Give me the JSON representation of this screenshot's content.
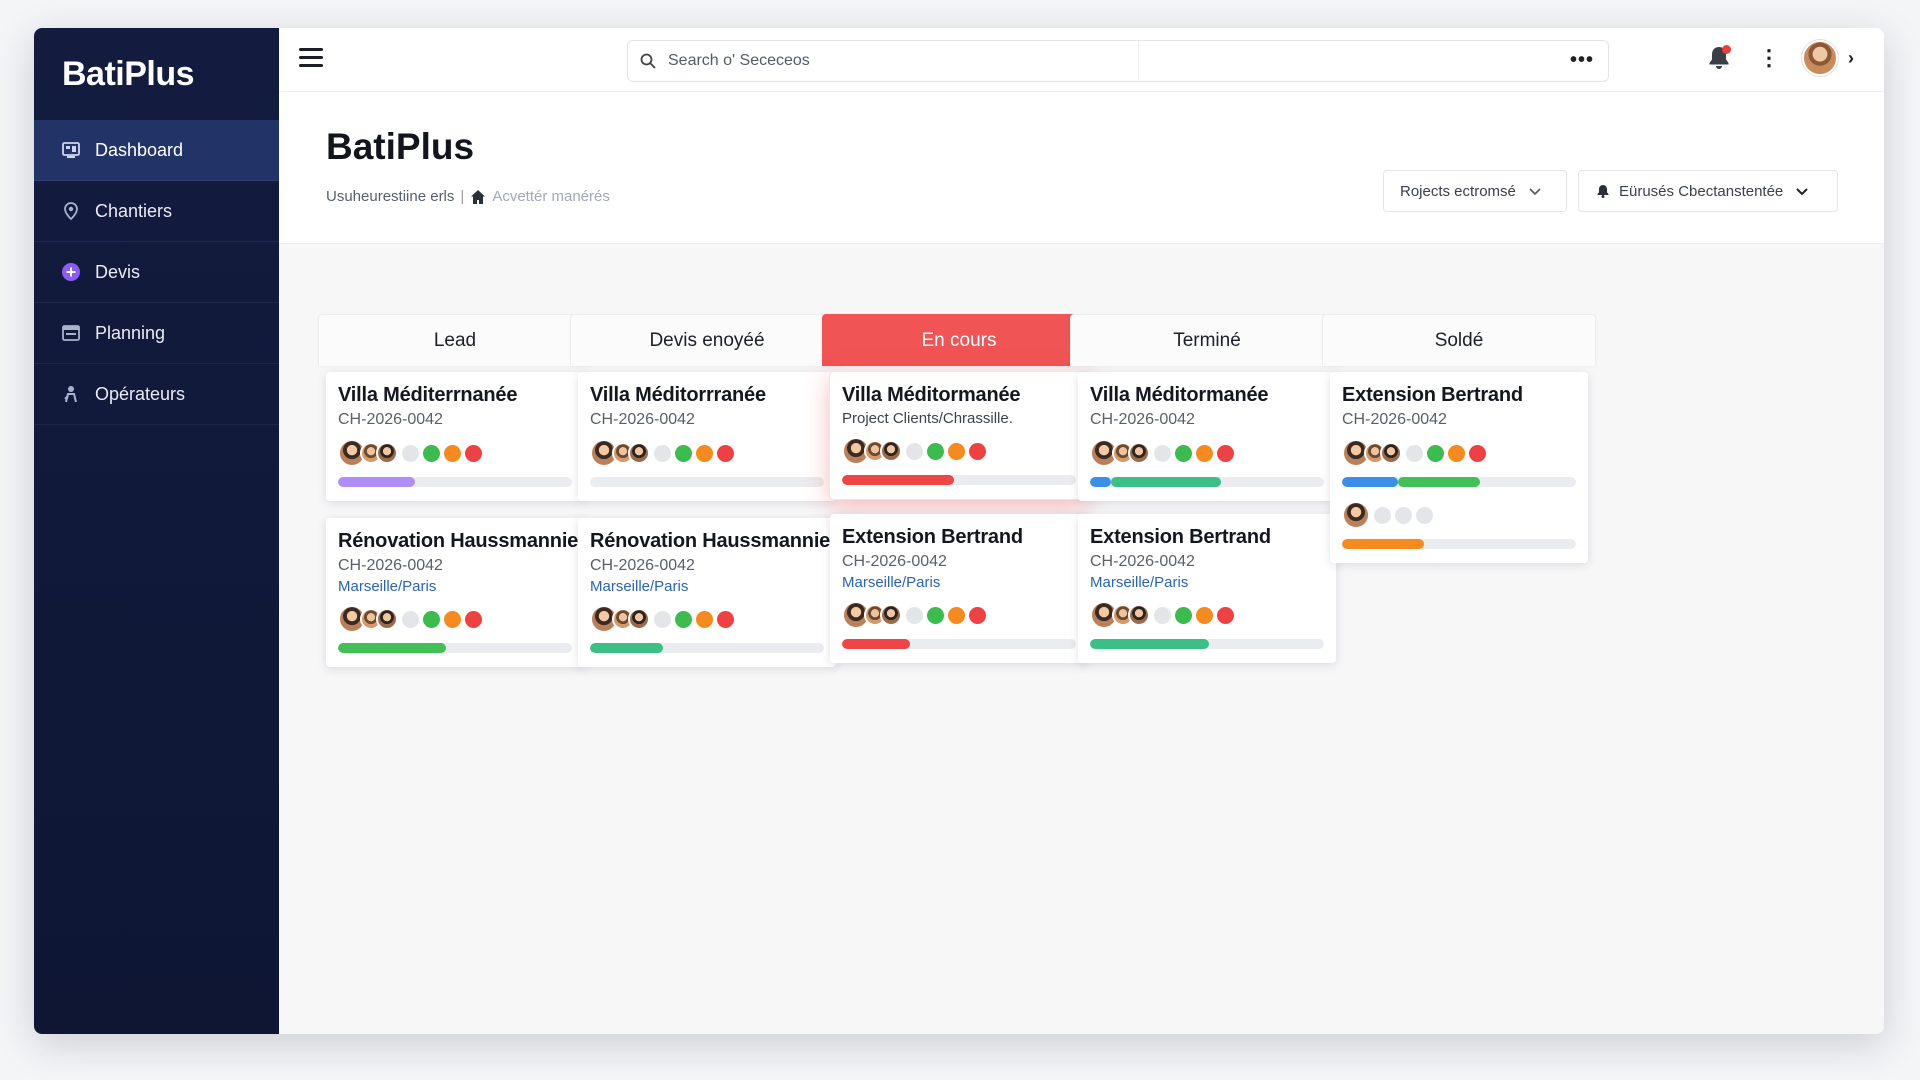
{
  "app": {
    "brand": "BatiPlus"
  },
  "sidebar": {
    "items": [
      {
        "label": "Dashboard",
        "icon": "dashboard-icon",
        "active": true
      },
      {
        "label": "Chantiers",
        "icon": "location-pin-icon",
        "active": false
      },
      {
        "label": "Devis",
        "icon": "plus-circle-icon",
        "active": false
      },
      {
        "label": "Planning",
        "icon": "calendar-icon",
        "active": false
      },
      {
        "label": "Opérateurs",
        "icon": "worker-icon",
        "active": false
      }
    ]
  },
  "topbar": {
    "search_placeholder": "Search o' Sececeos",
    "more_label": "•••",
    "kebab_label": "⋮",
    "chevron_label": "›"
  },
  "page": {
    "title": "BatiPlus",
    "breadcrumb": {
      "first": "Usuheurestiine erls",
      "separator": "|",
      "second": "Acvettér manérés"
    },
    "filters": [
      {
        "label": "Rojects ectromsé"
      },
      {
        "label": "Eürusés Cbectanstentée"
      }
    ]
  },
  "colors": {
    "sidebar_bg": "#131c3f",
    "active_item": "#223368",
    "accent_red": "#f05454",
    "link_blue": "#2b64b5"
  },
  "board": {
    "columns": [
      {
        "title": "Lead",
        "highlight": false,
        "cards": [
          {
            "title": "Villa Méditerrnanée",
            "code": "CH-2026-0042",
            "sub": "",
            "avatars": 3,
            "dots": [
              "grey",
              "green",
              "orange",
              "red"
            ],
            "progress": [
              {
                "color": "#b08ef7",
                "value": 0.33
              }
            ]
          },
          {
            "title": "Rénovation Haussmannien",
            "code": "CH-2026-0042",
            "sub": "Marseille/Paris",
            "avatars": 3,
            "dots": [
              "grey",
              "green",
              "orange",
              "red"
            ],
            "progress": [
              {
                "color": "#43bf57",
                "value": 0.46
              }
            ]
          }
        ]
      },
      {
        "title": "Devis enoyéé",
        "highlight": false,
        "cards": [
          {
            "title": "Villa Méditorrranée",
            "code": "CH-2026-0042",
            "sub": "",
            "avatars": 3,
            "dots": [
              "grey",
              "green",
              "orange",
              "red"
            ],
            "progress": []
          },
          {
            "title": "Rénovation Haussmannien",
            "code": "CH-2026-0042",
            "sub": "Marseille/Paris",
            "avatars": 3,
            "dots": [
              "grey",
              "green",
              "orange",
              "red"
            ],
            "progress": [
              {
                "color": "#3bbf87",
                "value": 0.31
              }
            ]
          }
        ]
      },
      {
        "title": "En cours",
        "highlight": true,
        "cards": [
          {
            "title": "Villa Méditormanée",
            "code": "",
            "sub": "Project Clients/Chrassille.",
            "sub_dark": true,
            "avatars": 3,
            "dots": [
              "grey",
              "green",
              "orange",
              "red"
            ],
            "progress": [
              {
                "color": "#ef4545",
                "value": 0.48
              }
            ],
            "glow": true
          },
          {
            "title": "Extension Bertrand",
            "code": "CH-2026-0042",
            "sub": "Marseille/Paris",
            "avatars": 3,
            "dots": [
              "grey",
              "green",
              "orange",
              "red"
            ],
            "progress": [
              {
                "color": "#ef4545",
                "value": 0.29
              }
            ]
          }
        ]
      },
      {
        "title": "Terminé",
        "highlight": false,
        "cards": [
          {
            "title": "Villa Méditormanée",
            "code": "CH-2026-0042",
            "sub": "",
            "avatars": 3,
            "dots": [
              "grey",
              "green",
              "orange",
              "red"
            ],
            "progress": [
              {
                "color": "#3b8fe8",
                "value": 0.09
              },
              {
                "color": "#3bbf87",
                "value": 0.47
              }
            ]
          },
          {
            "title": "Extension Bertrand",
            "code": "CH-2026-0042",
            "sub": "Marseille/Paris",
            "avatars": 3,
            "dots": [
              "grey",
              "green",
              "orange",
              "red"
            ],
            "progress": [
              {
                "color": "#3bbf87",
                "value": 0.51
              }
            ]
          }
        ]
      },
      {
        "title": "Soldé",
        "highlight": false,
        "cards": [
          {
            "title": "Extension Bertrand",
            "code": "CH-2026-0042",
            "sub": "",
            "avatars": 3,
            "dots": [
              "grey",
              "green",
              "orange",
              "red"
            ],
            "progress": [
              {
                "color": "#3b8fe8",
                "value": 0.24
              },
              {
                "color": "#43bf57",
                "value": 0.35
              }
            ],
            "extra": {
              "avatars": 1,
              "dots": [
                "grey",
                "grey",
                "grey"
              ],
              "progress": [
                {
                  "color": "#f58a1f",
                  "value": 0.35
                }
              ]
            }
          }
        ]
      }
    ]
  }
}
